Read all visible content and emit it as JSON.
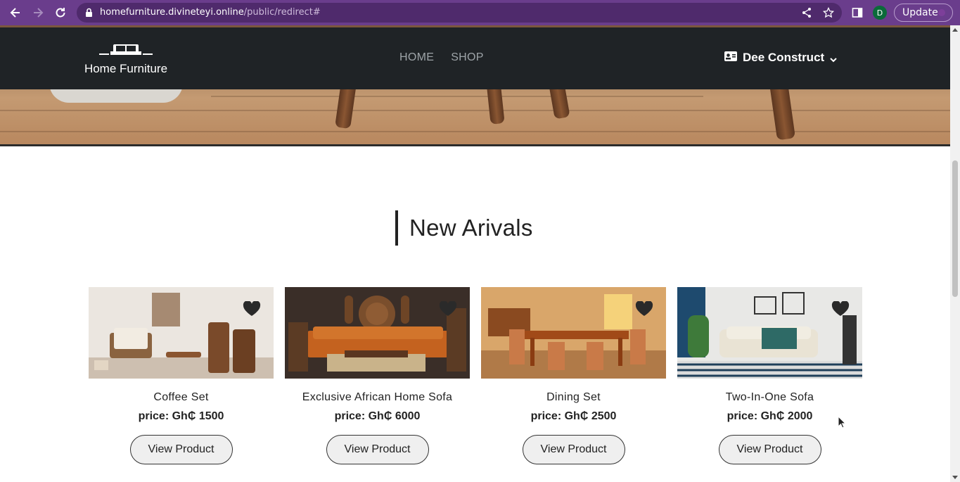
{
  "browser": {
    "url_host": "homefurniture.divineteyi.online",
    "url_path": "/public/redirect#",
    "profile_initial": "D",
    "update_label": "Update"
  },
  "site": {
    "brand": "Home Furniture",
    "nav": [
      "HOME",
      "SHOP"
    ],
    "account_name": "Dee Construct"
  },
  "section": {
    "title": "New Arivals"
  },
  "products": [
    {
      "name": "Coffee Set",
      "price": "price: Gh₵ 1500",
      "button": "View Product"
    },
    {
      "name": "Exclusive African Home Sofa",
      "price": "price: Gh₵ 6000",
      "button": "View Product"
    },
    {
      "name": "Dining Set",
      "price": "price: Gh₵ 2500",
      "button": "View Product"
    },
    {
      "name": "Two-In-One Sofa",
      "price": "price: Gh₵ 2000",
      "button": "View Product"
    }
  ],
  "colors": {
    "browser_chrome": "#6a3d8c",
    "navbar": "#1f2326",
    "profile_avatar": "#0b6b3a"
  }
}
